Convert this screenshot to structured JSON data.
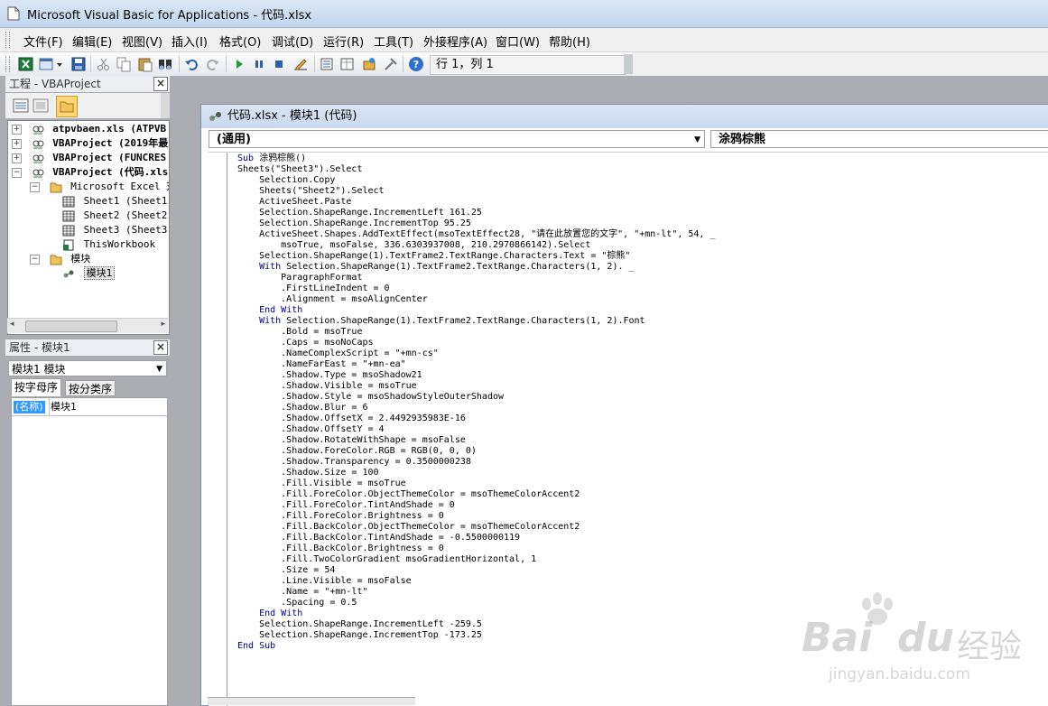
{
  "window": {
    "title": "Microsoft Visual Basic for Applications - 代码.xlsx"
  },
  "menubar": {
    "items": [
      "文件(F)",
      "编辑(E)",
      "视图(V)",
      "插入(I)",
      "格式(O)",
      "调试(D)",
      "运行(R)",
      "工具(T)",
      "外接程序(A)",
      "窗口(W)",
      "帮助(H)"
    ]
  },
  "toolbar": {
    "position": "行 1，列 1"
  },
  "project_panel": {
    "title": "工程 - VBAProject",
    "tree": [
      {
        "label": "atpvbaen.xls (ATPVB",
        "bold": true
      },
      {
        "label": "VBAProject (2019年最",
        "bold": true
      },
      {
        "label": "VBAProject (FUNCRES",
        "bold": true
      },
      {
        "label": "VBAProject (代码.xls",
        "bold": true
      },
      {
        "label": "Microsoft Excel 对象"
      },
      {
        "label": "Sheet1 (Sheet1)"
      },
      {
        "label": "Sheet2 (Sheet2)"
      },
      {
        "label": "Sheet3 (Sheet3)"
      },
      {
        "label": "ThisWorkbook"
      },
      {
        "label": "模块"
      },
      {
        "label": "模块1"
      }
    ]
  },
  "properties_panel": {
    "title": "属性 - 模块1",
    "object": "模块1 模块",
    "tabs": [
      "按字母序",
      "按分类序"
    ],
    "property_name": "(名称)",
    "property_value": "模块1"
  },
  "code_window": {
    "title": "代码.xlsx - 模块1 (代码)",
    "object_combo": "(通用)",
    "proc_combo": "涂鸦棕熊",
    "lines": [
      "Sub 涂鸦棕熊()",
      "Sheets(\"Sheet3\").Select",
      "    Selection.Copy",
      "    Sheets(\"Sheet2\").Select",
      "    ActiveSheet.Paste",
      "    Selection.ShapeRange.IncrementLeft 161.25",
      "    Selection.ShapeRange.IncrementTop 95.25",
      "    ActiveSheet.Shapes.AddTextEffect(msoTextEffect28, \"请在此放置您的文字\", \"+mn-lt\", 54, _",
      "        msoTrue, msoFalse, 336.6303937008, 210.2970866142).Select",
      "    Selection.ShapeRange(1).TextFrame2.TextRange.Characters.Text = \"棕熊\"",
      "    With Selection.ShapeRange(1).TextFrame2.TextRange.Characters(1, 2). _",
      "        ParagraphFormat",
      "        .FirstLineIndent = 0",
      "        .Alignment = msoAlignCenter",
      "    End With",
      "    With Selection.ShapeRange(1).TextFrame2.TextRange.Characters(1, 2).Font",
      "        .Bold = msoTrue",
      "        .Caps = msoNoCaps",
      "        .NameComplexScript = \"+mn-cs\"",
      "        .NameFarEast = \"+mn-ea\"",
      "        .Shadow.Type = msoShadow21",
      "        .Shadow.Visible = msoTrue",
      "        .Shadow.Style = msoShadowStyleOuterShadow",
      "        .Shadow.Blur = 6",
      "        .Shadow.OffsetX = 2.4492935983E-16",
      "        .Shadow.OffsetY = 4",
      "        .Shadow.RotateWithShape = msoFalse",
      "        .Shadow.ForeColor.RGB = RGB(0, 0, 0)",
      "        .Shadow.Transparency = 0.3500000238",
      "        .Shadow.Size = 100",
      "        .Fill.Visible = msoTrue",
      "        .Fill.ForeColor.ObjectThemeColor = msoThemeColorAccent2",
      "        .Fill.ForeColor.TintAndShade = 0",
      "        .Fill.ForeColor.Brightness = 0",
      "        .Fill.BackColor.ObjectThemeColor = msoThemeColorAccent2",
      "        .Fill.BackColor.TintAndShade = -0.5500000119",
      "        .Fill.BackColor.Brightness = 0",
      "        .Fill.TwoColorGradient msoGradientHorizontal, 1",
      "        .Size = 54",
      "        .Line.Visible = msoFalse",
      "        .Name = \"+mn-lt\"",
      "        .Spacing = 0.5",
      "    End With",
      "    Selection.ShapeRange.IncrementLeft -259.5",
      "    Selection.ShapeRange.IncrementTop -173.25",
      "End Sub"
    ]
  },
  "watermark": {
    "brand": "Bai",
    "brand2": "du",
    "cn": "经验",
    "url": "jingyan.baidu.com"
  },
  "colors": {
    "keyword": "#00007f",
    "title_bar": "#c8d8ed",
    "mdi_bg": "#abadb3"
  }
}
